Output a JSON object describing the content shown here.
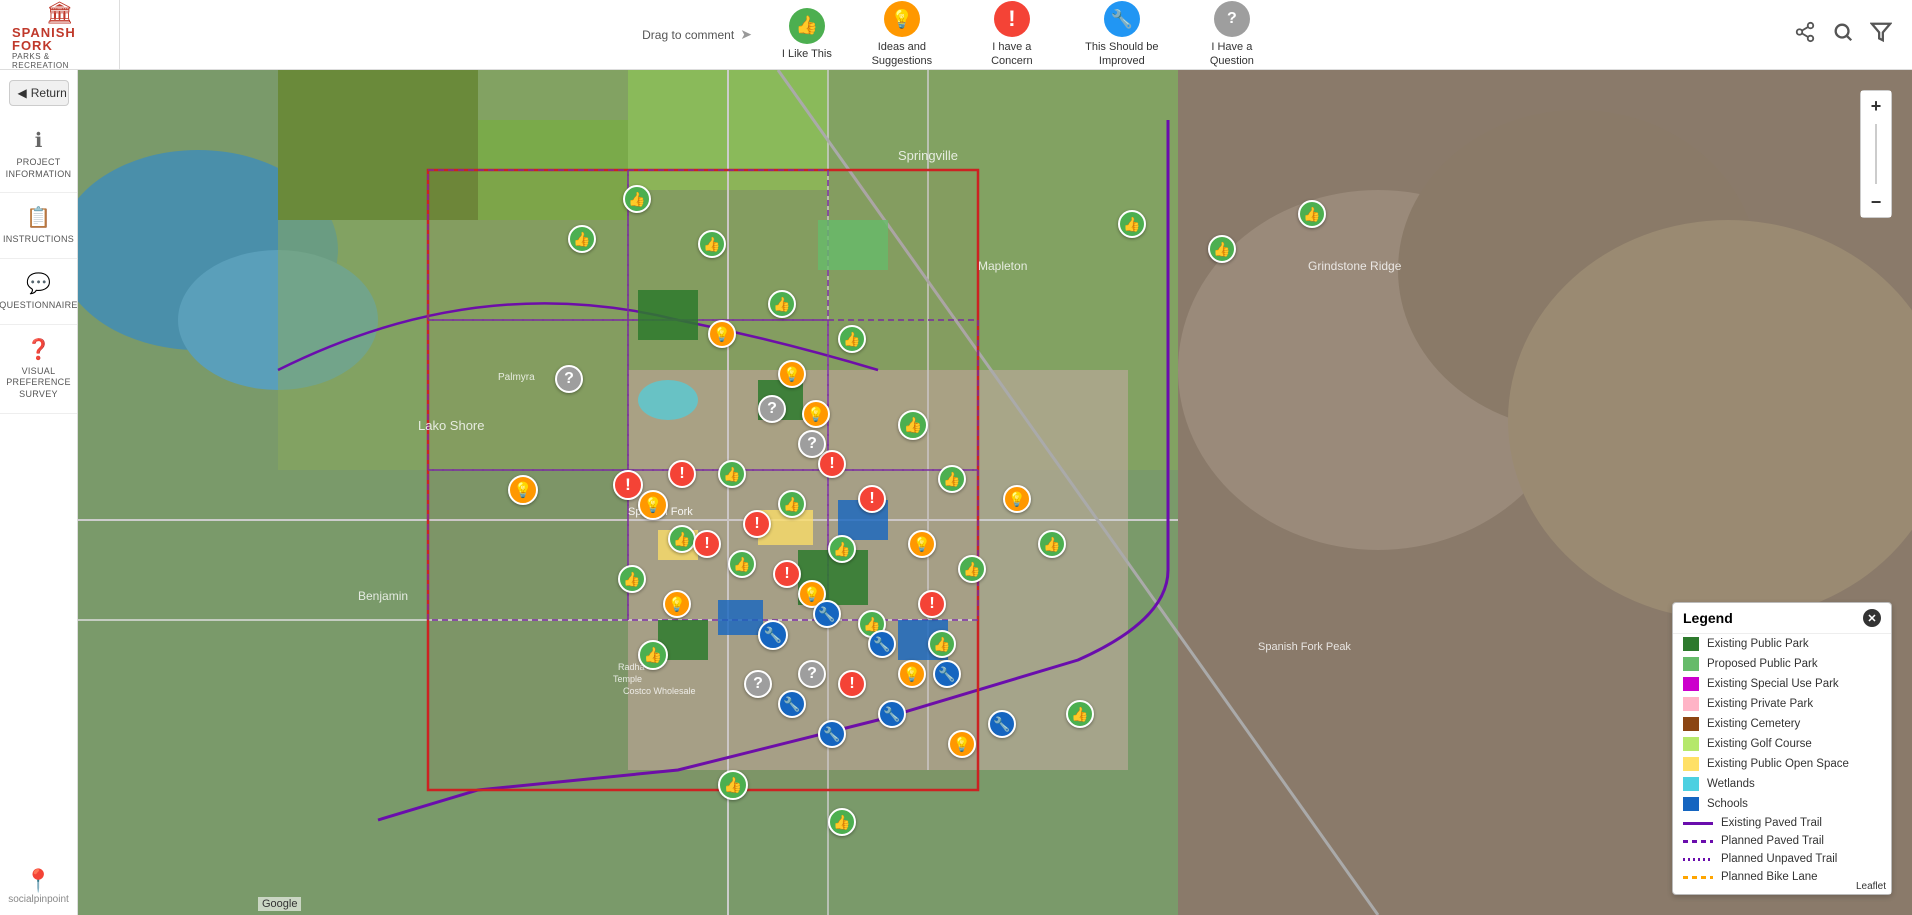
{
  "header": {
    "logo": {
      "main": "SPANISH FORK",
      "sub": "PARKS & RECREATION",
      "icon": "🏛"
    },
    "drag_label": "Drag to comment",
    "tools": [
      {
        "id": "i-like-this",
        "label": "I Like This",
        "icon": "👍",
        "color": "icon-green"
      },
      {
        "id": "ideas-suggestions",
        "label": "Ideas and Suggestions",
        "icon": "💡",
        "color": "icon-orange"
      },
      {
        "id": "concern",
        "label": "I have a Concern",
        "icon": "❗",
        "color": "icon-red"
      },
      {
        "id": "improve",
        "label": "This Should be Improved",
        "icon": "🔧",
        "color": "icon-blue"
      },
      {
        "id": "question",
        "label": "I Have a Question",
        "icon": "?",
        "color": "icon-gray"
      }
    ],
    "actions": {
      "share": "⬆",
      "search": "🔍",
      "filter": "⬜"
    }
  },
  "sidebar": {
    "return_label": "Return",
    "items": [
      {
        "id": "project-information",
        "icon": "ℹ",
        "label": "PROJECT INFORMATION"
      },
      {
        "id": "instructions",
        "icon": "📋",
        "label": "INSTRUCTIONS"
      },
      {
        "id": "questionnaire",
        "icon": "💬",
        "label": "QUESTIONNAIRE"
      },
      {
        "id": "visual-preference",
        "icon": "❓",
        "label": "VISUAL PREFERENCE SURVEY"
      }
    ],
    "social_label": "socialpinpoint"
  },
  "map": {
    "zoom_in": "+",
    "zoom_out": "−",
    "leaflet_credit": "Leaflet"
  },
  "legend": {
    "title": "Legend",
    "close_icon": "✕",
    "items": [
      {
        "id": "existing-public-park",
        "label": "Existing Public Park",
        "type": "fill",
        "color": "#2d7a2d"
      },
      {
        "id": "proposed-public-park",
        "label": "Proposed Public Park",
        "type": "fill",
        "color": "#66bb6a"
      },
      {
        "id": "existing-special-use-park",
        "label": "Existing Special Use Park",
        "type": "fill",
        "color": "#cc00cc"
      },
      {
        "id": "existing-private-park",
        "label": "Existing Private Park",
        "type": "fill",
        "color": "#ffb3c6"
      },
      {
        "id": "existing-cemetery",
        "label": "Existing Cemetery",
        "type": "fill",
        "color": "#8B4513"
      },
      {
        "id": "existing-golf-course",
        "label": "Existing Golf Course",
        "type": "fill",
        "color": "#b5e86b"
      },
      {
        "id": "existing-public-open-space",
        "label": "Existing Public Open Space",
        "type": "fill",
        "color": "#ffe066"
      },
      {
        "id": "wetlands",
        "label": "Wetlands",
        "type": "fill",
        "color": "#4dd0e1"
      },
      {
        "id": "schools",
        "label": "Schools",
        "type": "fill",
        "color": "#1565c0"
      },
      {
        "id": "existing-paved-trail",
        "label": "Existing Paved Trail",
        "type": "line",
        "color": "#6a0dad",
        "style": "solid"
      },
      {
        "id": "planned-paved-trail",
        "label": "Planned Paved Trail",
        "type": "line",
        "color": "#6a0dad",
        "style": "dashed"
      },
      {
        "id": "planned-unpaved-trail",
        "label": "Planned Unpaved Trail",
        "type": "line",
        "color": "#6a0dad",
        "style": "dotted"
      },
      {
        "id": "planned-bike-lane",
        "label": "Planned Bike Lane",
        "type": "line",
        "color": "#ffa500",
        "style": "dashed"
      }
    ]
  }
}
